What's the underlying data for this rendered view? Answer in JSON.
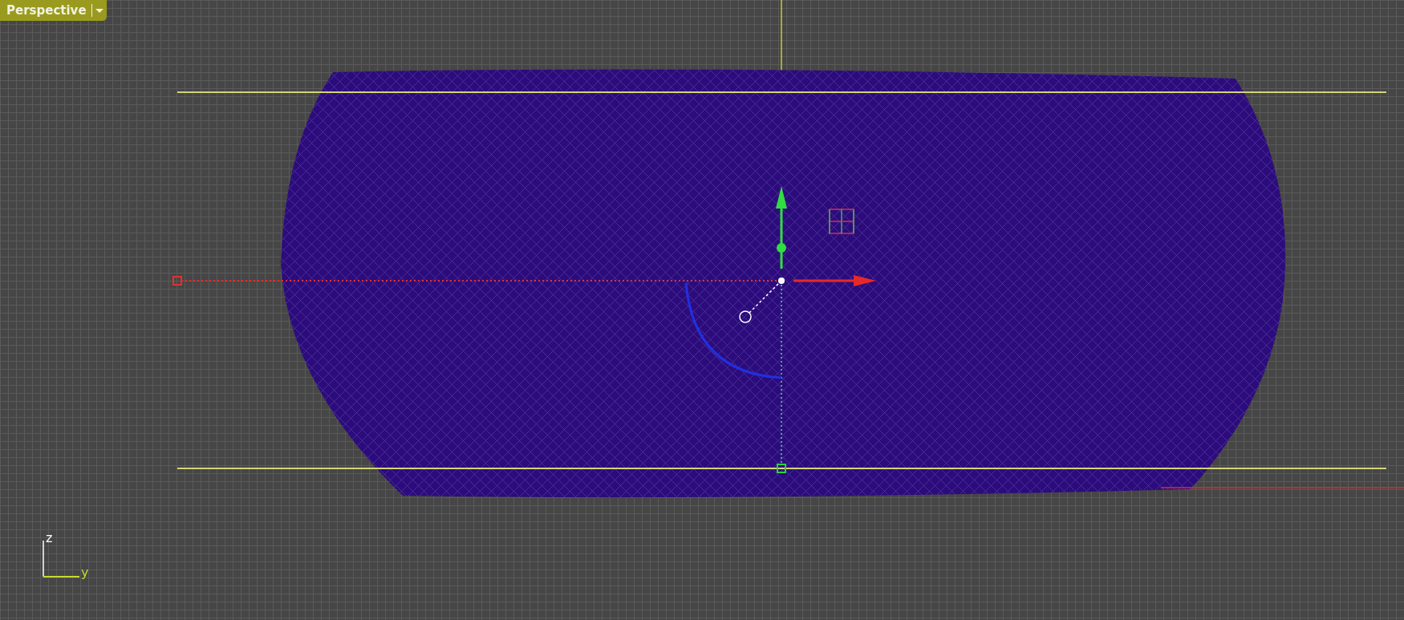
{
  "viewport": {
    "title": "Perspective",
    "axis_labels": [
      "z",
      "y"
    ]
  }
}
